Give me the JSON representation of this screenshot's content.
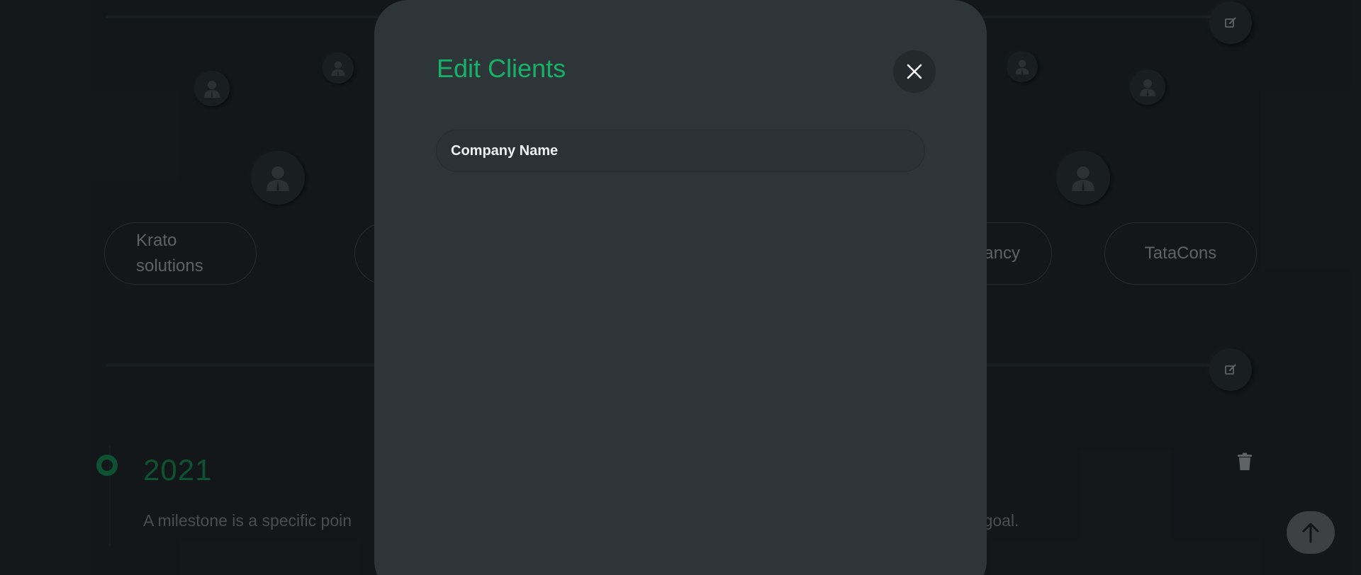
{
  "clients_section": {
    "pills": [
      {
        "label": "Krato solutions"
      },
      {
        "label": ""
      },
      {
        "label": "ancy"
      },
      {
        "label": "TataCons"
      }
    ]
  },
  "milestone": {
    "year": "2021",
    "description_left": "A milestone is a specific poin",
    "description_right": "te goal."
  },
  "modal": {
    "title": "Edit Clients",
    "company_input": {
      "placeholder": "Company Name",
      "value": ""
    }
  },
  "icons": {
    "edit": "edit-icon",
    "avatar": "user-avatar-icon",
    "close": "close-icon",
    "trash": "trash-icon",
    "scroll_top": "arrow-up-icon"
  },
  "colors": {
    "accent": "#17b26a",
    "milestone_green": "#167a4c",
    "background": "#1d2325",
    "modal_bg": "#2e3538"
  }
}
